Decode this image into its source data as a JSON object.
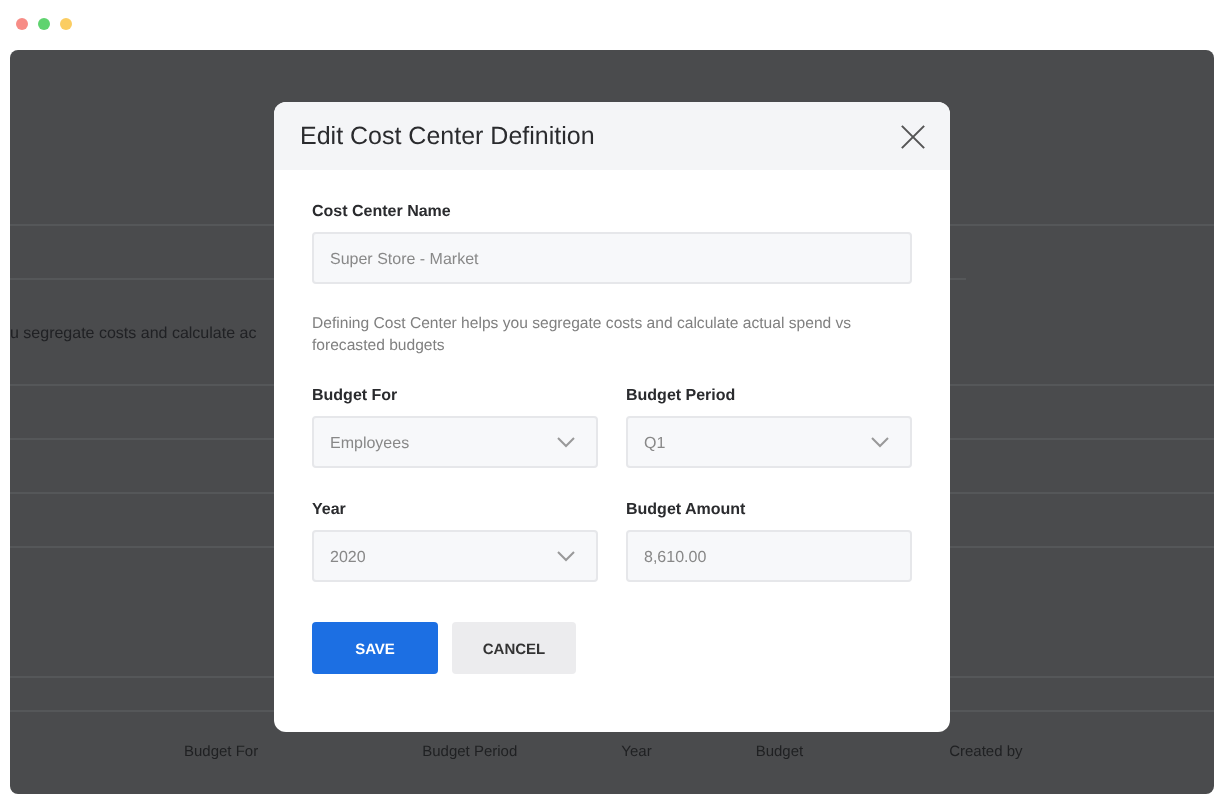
{
  "background": {
    "description_fragment": "u segregate costs and calculate ac",
    "table": {
      "columns": [
        "Budget For",
        "Budget Period",
        "Year",
        "Budget",
        "Created by"
      ]
    }
  },
  "dialog": {
    "title": "Edit Cost Center Definition",
    "name_field": {
      "label": "Cost Center Name",
      "kind": "text",
      "value": "Super Store - Market"
    },
    "description": "Defining Cost Center helps you segregate costs and calculate actual spend vs forecasted budgets",
    "fields": [
      {
        "label": "Budget For",
        "kind": "select",
        "value": "Employees"
      },
      {
        "label": "Budget Period",
        "kind": "select",
        "value": "Q1"
      },
      {
        "label": "Year",
        "kind": "select",
        "value": "2020"
      },
      {
        "label": "Budget Amount",
        "kind": "text",
        "value": "8,610.00"
      }
    ],
    "buttons": [
      {
        "label": "SAVE",
        "kind": "primary"
      },
      {
        "label": "CANCEL",
        "kind": "secondary"
      }
    ]
  }
}
